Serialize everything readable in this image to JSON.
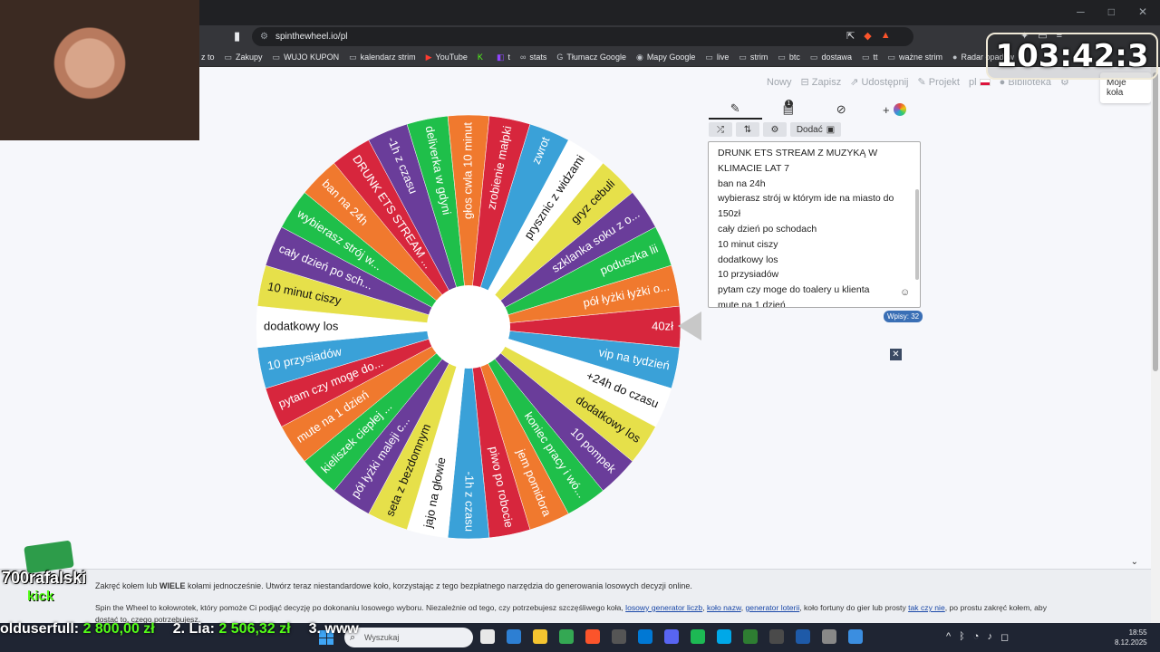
{
  "browser": {
    "url": "spinthewheel.io/pl",
    "bookmarks": [
      {
        "label": "z to",
        "icon": ""
      },
      {
        "label": "Zakupy",
        "icon": "folder-icon"
      },
      {
        "label": "WUJO KUPON",
        "icon": "folder-icon"
      },
      {
        "label": "kalendarz strim",
        "icon": "folder-icon"
      },
      {
        "label": "YouTube",
        "icon": "youtube-icon"
      },
      {
        "label": "",
        "icon": "kick-icon"
      },
      {
        "label": "t",
        "icon": "twitch-icon"
      },
      {
        "label": "stats",
        "icon": "link-icon"
      },
      {
        "label": "Tłumacz Google",
        "icon": "translate-icon"
      },
      {
        "label": "Mapy Google",
        "icon": "maps-icon"
      },
      {
        "label": "live",
        "icon": "folder-icon"
      },
      {
        "label": "strim",
        "icon": "folder-icon"
      },
      {
        "label": "btc",
        "icon": "folder-icon"
      },
      {
        "label": "dostawa",
        "icon": "folder-icon"
      },
      {
        "label": "tt",
        "icon": "folder-icon"
      },
      {
        "label": "ważne strim",
        "icon": "folder-icon"
      },
      {
        "label": "Radar opadów",
        "icon": "weather-icon"
      }
    ]
  },
  "site_nav": {
    "new": "Nowy",
    "save": "Zapisz",
    "share": "Udostępnij",
    "project": "Projekt",
    "lang": "pl",
    "library": "Biblioteka",
    "my_wheels": "Moje koła"
  },
  "wheel": {
    "pointer_text": "40zł",
    "segments": [
      {
        "label": "40zł",
        "color": "#d7263d"
      },
      {
        "label": "vip na tydzień",
        "color": "#3aa1d8"
      },
      {
        "label": "+24h do czasu",
        "color": "#ffffff"
      },
      {
        "label": "dodatkowy los",
        "color": "#e6e04a"
      },
      {
        "label": "10 pompek",
        "color": "#6a3d9a"
      },
      {
        "label": "koniec pracy i wó...",
        "color": "#1fbf4a"
      },
      {
        "label": "jem pomidora",
        "color": "#f0792e"
      },
      {
        "label": "piwo po robocie",
        "color": "#d7263d"
      },
      {
        "label": "-1h z czasu",
        "color": "#3aa1d8"
      },
      {
        "label": "jajo na głowie",
        "color": "#ffffff"
      },
      {
        "label": "seta z bezdomnym",
        "color": "#e6e04a"
      },
      {
        "label": "pół łyżki maleji c...",
        "color": "#6a3d9a"
      },
      {
        "label": "kieliszek ciepłej ...",
        "color": "#1fbf4a"
      },
      {
        "label": "mute na 1 dzień",
        "color": "#f0792e"
      },
      {
        "label": "pytam czy moge do...",
        "color": "#d7263d"
      },
      {
        "label": "10 przysiadów",
        "color": "#3aa1d8"
      },
      {
        "label": "dodatkowy los",
        "color": "#ffffff"
      },
      {
        "label": "10 minut ciszy",
        "color": "#e6e04a"
      },
      {
        "label": "cały dzień po sch...",
        "color": "#6a3d9a"
      },
      {
        "label": "wybierasz strój w...",
        "color": "#1fbf4a"
      },
      {
        "label": "ban na 24h",
        "color": "#f0792e"
      },
      {
        "label": "DRUNK ETS STREAM ...",
        "color": "#d7263d"
      },
      {
        "label": "-1h z czasu",
        "color": "#6a3d9a"
      },
      {
        "label": "deliverka w gdyni",
        "color": "#1fbf4a"
      },
      {
        "label": "głos cwla 10 minut",
        "color": "#f0792e"
      },
      {
        "label": "zrobienie małpki",
        "color": "#d7263d"
      },
      {
        "label": "zwrot",
        "color": "#3aa1d8"
      },
      {
        "label": "prysznic z widzami",
        "color": "#ffffff"
      },
      {
        "label": "gryz cebuli",
        "color": "#e6e04a"
      },
      {
        "label": "szklanka soku z o...",
        "color": "#6a3d9a"
      },
      {
        "label": "poduszka lii",
        "color": "#1fbf4a"
      },
      {
        "label": "pół łyżki łyżki o...",
        "color": "#f0792e"
      }
    ]
  },
  "editor": {
    "add_label": "Dodać",
    "entries": [
      "DRUNK ETS STREAM Z MUZYKĄ W",
      "KLIMACIE LAT 7",
      "ban na 24h",
      "wybierasz strój w którym ide na miasto do",
      "150zł",
      "cały dzień po schodach",
      "10 minut ciszy",
      "dodatkowy los",
      "10 przysiadów",
      "pytam czy moge do toalery u klienta",
      "mute na 1 dzień"
    ],
    "count_label": "Wpisy: 32",
    "badge": "1"
  },
  "info": {
    "line1_pre": "Zakręć kołem lub ",
    "line1_bold": "WIELE",
    "line1_post": " kołami jednocześnie. Utwórz teraz niestandardowe koło, korzystając z tego bezpłatnego narzędzia do generowania losowych decyzji online.",
    "line2_pre": "Spin the Wheel to kołowrotek, który pomoże Ci podjąć decyzję po dokonaniu losowego wyboru. Niezależnie od tego, czy potrzebujesz szczęśliwego koła, ",
    "link1": "losowy generator liczb",
    "link2": "koło nazw",
    "link3": "generator loterii",
    "line2_mid": ", koło fortuny do gier lub prosty ",
    "link4": "tak czy nie",
    "line2_post": ", po prostu zakręć kołem, aby dostać to, czego potrzebujesz."
  },
  "taskbar": {
    "search_placeholder": "Wyszukaj",
    "time": "18:55",
    "date": "8.12.2025"
  },
  "overlay": {
    "timer": "103:42:3",
    "channel": "700rafalski",
    "kick": "kick",
    "donor1": "olduserfull:",
    "donor1_amt": "2 800,00 zł",
    "donor2": "2. Lia:",
    "donor2_amt": "2 506,32 zł",
    "donor3": "3. www"
  },
  "colors": {
    "accent_blue": "#3a6fb5",
    "kick_green": "#53fc18"
  }
}
